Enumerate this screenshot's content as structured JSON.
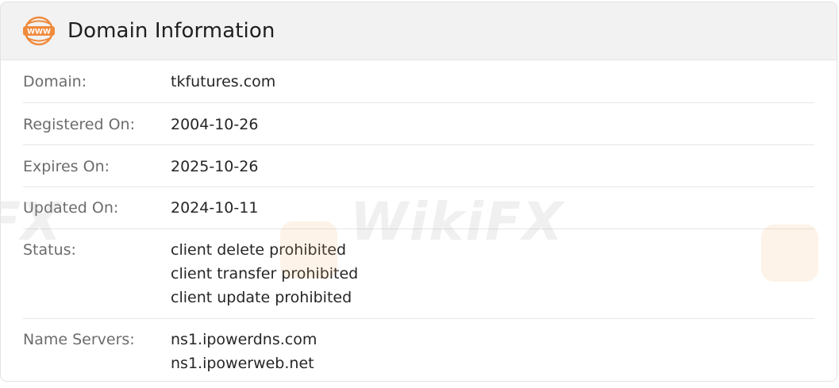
{
  "header": {
    "title": "Domain Information",
    "icon": "www-globe-icon",
    "icon_text": "WWW",
    "accent_color": "#f08a3c"
  },
  "rows": [
    {
      "label": "Domain:",
      "values": [
        "tkfutures.com"
      ]
    },
    {
      "label": "Registered On:",
      "values": [
        "2004-10-26"
      ]
    },
    {
      "label": "Expires On:",
      "values": [
        "2025-10-26"
      ]
    },
    {
      "label": "Updated On:",
      "values": [
        "2024-10-11"
      ]
    },
    {
      "label": "Status:",
      "values": [
        "client delete prohibited",
        "client transfer prohibited",
        "client update prohibited"
      ]
    },
    {
      "label": "Name Servers:",
      "values": [
        "ns1.ipowerdns.com",
        "ns1.ipowerweb.net"
      ]
    }
  ],
  "watermark": {
    "text": "WikiFX",
    "text_partial": "FX"
  }
}
